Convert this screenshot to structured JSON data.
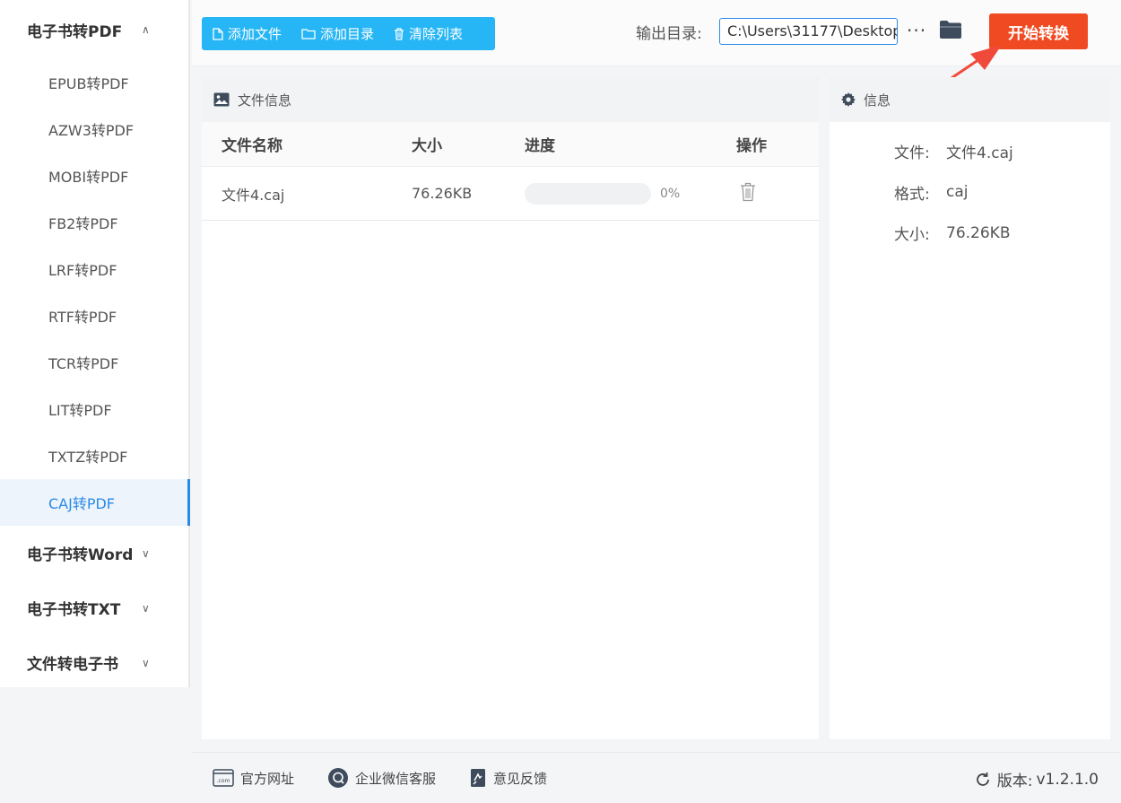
{
  "sidebar": {
    "groups": [
      {
        "label": "电子书转PDF",
        "expanded": true,
        "items": [
          "EPUB转PDF",
          "AZW3转PDF",
          "MOBI转PDF",
          "FB2转PDF",
          "LRF转PDF",
          "RTF转PDF",
          "TCR转PDF",
          "LIT转PDF",
          "TXTZ转PDF",
          "CAJ转PDF"
        ],
        "active_item": "CAJ转PDF"
      },
      {
        "label": "电子书转Word",
        "expanded": false
      },
      {
        "label": "电子书转TXT",
        "expanded": false
      },
      {
        "label": "文件转电子书",
        "expanded": false
      }
    ]
  },
  "toolbar": {
    "add_file": "添加文件",
    "add_dir": "添加目录",
    "clear_list": "清除列表",
    "output_label": "输出目录:",
    "output_path": "C:\\Users\\31177\\Desktop",
    "more": "···",
    "start": "开始转换"
  },
  "file_panel": {
    "title": "文件信息",
    "columns": {
      "name": "文件名称",
      "size": "大小",
      "progress": "进度",
      "op": "操作"
    },
    "rows": [
      {
        "name": "文件4.caj",
        "size": "76.26KB",
        "progress": 0,
        "progress_text": "0%"
      }
    ]
  },
  "info_panel": {
    "title": "信息",
    "fields": [
      {
        "key": "文件:",
        "value": "文件4.caj"
      },
      {
        "key": "格式:",
        "value": "caj"
      },
      {
        "key": "大小:",
        "value": "76.26KB"
      }
    ]
  },
  "footer": {
    "website": "官方网址",
    "wechat": "企业微信客服",
    "feedback": "意见反馈",
    "version_label": "版本:",
    "version": "v1.2.1.0"
  },
  "colors": {
    "accent": "#2b8ae6",
    "toolbar_btn": "#27b6f5",
    "start_btn": "#f04a22",
    "arrow": "#f04a3a"
  }
}
